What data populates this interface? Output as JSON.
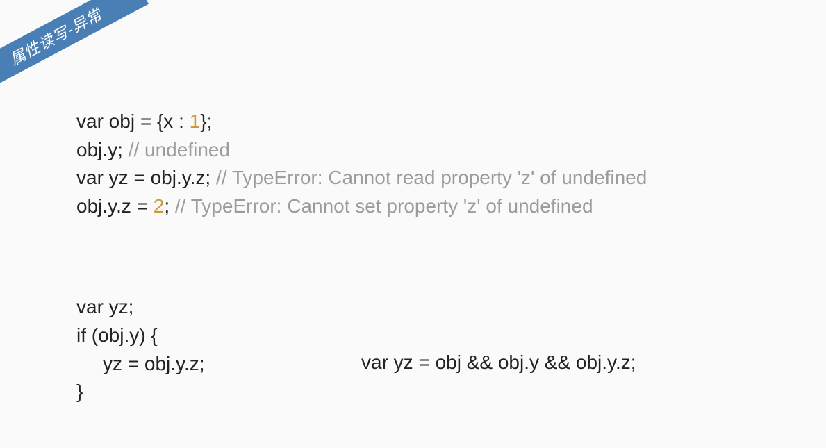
{
  "ribbon": {
    "title": "属性读写-异常"
  },
  "block1": {
    "l1_a": "var obj = {x : ",
    "l1_num": "1",
    "l1_b": "};",
    "l2_a": "obj.y; ",
    "l2_comment": "// undefined",
    "l3_a": "var yz = obj.y.z; ",
    "l3_comment": "// TypeError: Cannot read property 'z' of undefined",
    "l4_a": "obj.y.z = ",
    "l4_num": "2",
    "l4_b": "; ",
    "l4_comment": "// TypeError: Cannot set property 'z' of undefined"
  },
  "block2": {
    "l1": "var yz;",
    "l2": "if (obj.y) {",
    "l3": "yz = obj.y.z;",
    "l4": "}",
    "right": "var yz = obj && obj.y && obj.y.z;"
  }
}
